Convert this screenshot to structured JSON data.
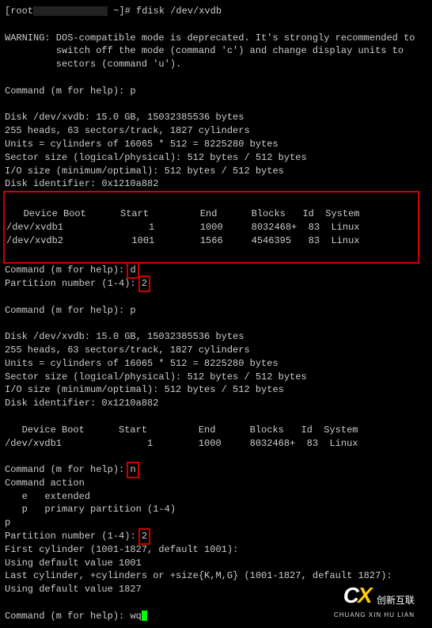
{
  "prompt_line": {
    "pre": "[root",
    "post": " ~]# fdisk /dev/xvdb"
  },
  "warning": [
    "WARNING: DOS-compatible mode is deprecated. It's strongly recommended to",
    "         switch off the mode (command 'c') and change display units to",
    "         sectors (command 'u')."
  ],
  "cmd_p1": "Command (m for help): p",
  "disk_info1": [
    "Disk /dev/xvdb: 15.0 GB, 15032385536 bytes",
    "255 heads, 63 sectors/track, 1827 cylinders",
    "Units = cylinders of 16065 * 512 = 8225280 bytes",
    "Sector size (logical/physical): 512 bytes / 512 bytes",
    "I/O size (minimum/optimal): 512 bytes / 512 bytes",
    "Disk identifier: 0x1210a882"
  ],
  "table1": {
    "header": "   Device Boot      Start         End      Blocks   Id  System",
    "rows": [
      "/dev/xvdb1               1        1000     8032468+  83  Linux",
      "/dev/xvdb2            1001        1566     4546395   83  Linux"
    ]
  },
  "cmd_d": {
    "label": "Command (m for help): ",
    "value": "d"
  },
  "part_d": {
    "label": "Partition number (1-4): ",
    "value": "2"
  },
  "cmd_p2": "Command (m for help): p",
  "disk_info2": [
    "Disk /dev/xvdb: 15.0 GB, 15032385536 bytes",
    "255 heads, 63 sectors/track, 1827 cylinders",
    "Units = cylinders of 16065 * 512 = 8225280 bytes",
    "Sector size (logical/physical): 512 bytes / 512 bytes",
    "I/O size (minimum/optimal): 512 bytes / 512 bytes",
    "Disk identifier: 0x1210a882"
  ],
  "table2": {
    "header": "   Device Boot      Start         End      Blocks   Id  System",
    "rows": [
      "/dev/xvdb1               1        1000     8032468+  83  Linux"
    ]
  },
  "cmd_n": {
    "label": "Command (m for help): ",
    "value": "n"
  },
  "cmd_action": [
    "Command action",
    "   e   extended",
    "   p   primary partition (1-4)"
  ],
  "p_choice": "p",
  "part_n": {
    "label": "Partition number (1-4): ",
    "value": "2"
  },
  "cyl_first": "First cylinder (1001-1827, default 1001):",
  "cyl_first_def": "Using default value 1001",
  "cyl_last": "Last cylinder, +cylinders or +size{K,M,G} (1001-1827, default 1827):",
  "cyl_last_def": "Using default value 1827",
  "cmd_wq": {
    "label": "Command (m for help): ",
    "value": "wq"
  },
  "logo": {
    "cn": "创新互联",
    "en": "CHUANG XIN HU LIAN"
  },
  "chart_data": {
    "type": "table",
    "partitions_before_delete": [
      {
        "device": "/dev/xvdb1",
        "boot": "",
        "start": 1,
        "end": 1000,
        "blocks": "8032468+",
        "id": 83,
        "system": "Linux"
      },
      {
        "device": "/dev/xvdb2",
        "boot": "",
        "start": 1001,
        "end": 1566,
        "blocks": "4546395",
        "id": 83,
        "system": "Linux"
      }
    ],
    "partitions_after_delete": [
      {
        "device": "/dev/xvdb1",
        "boot": "",
        "start": 1,
        "end": 1000,
        "blocks": "8032468+",
        "id": 83,
        "system": "Linux"
      }
    ],
    "disk": {
      "path": "/dev/xvdb",
      "size_gb": 15.0,
      "bytes": 15032385536,
      "heads": 255,
      "sectors_per_track": 63,
      "cylinders": 1827,
      "identifier": "0x1210a882"
    }
  }
}
